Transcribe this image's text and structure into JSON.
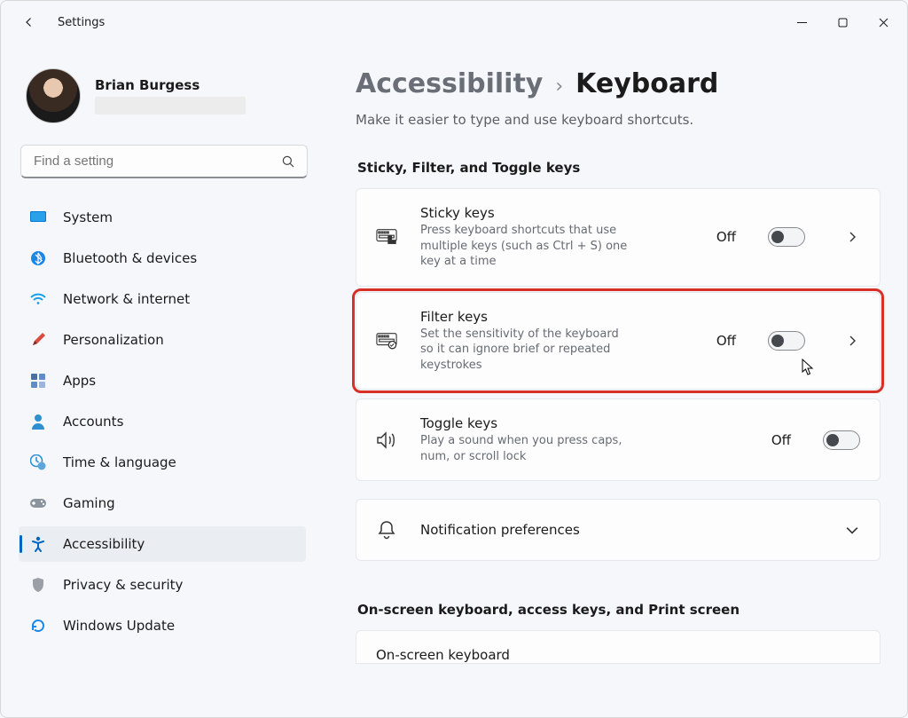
{
  "app_title": "Settings",
  "user": {
    "name": "Brian Burgess"
  },
  "search": {
    "placeholder": "Find a setting"
  },
  "nav": {
    "items": [
      {
        "id": "system",
        "label": "System"
      },
      {
        "id": "bluetooth",
        "label": "Bluetooth & devices"
      },
      {
        "id": "network",
        "label": "Network & internet"
      },
      {
        "id": "personalization",
        "label": "Personalization"
      },
      {
        "id": "apps",
        "label": "Apps"
      },
      {
        "id": "accounts",
        "label": "Accounts"
      },
      {
        "id": "time",
        "label": "Time & language"
      },
      {
        "id": "gaming",
        "label": "Gaming"
      },
      {
        "id": "accessibility",
        "label": "Accessibility",
        "selected": true
      },
      {
        "id": "privacy",
        "label": "Privacy & security"
      },
      {
        "id": "update",
        "label": "Windows Update"
      }
    ]
  },
  "breadcrumb": {
    "parent": "Accessibility",
    "current": "Keyboard"
  },
  "subtitle": "Make it easier to type and use keyboard shortcuts.",
  "sections": {
    "keys": {
      "heading": "Sticky, Filter, and Toggle keys",
      "sticky": {
        "title": "Sticky keys",
        "desc": "Press keyboard shortcuts that use multiple keys (such as Ctrl + S) one key at a time",
        "state": "Off"
      },
      "filter": {
        "title": "Filter keys",
        "desc": "Set the sensitivity of the keyboard so it can ignore brief or repeated keystrokes",
        "state": "Off"
      },
      "toggle": {
        "title": "Toggle keys",
        "desc": "Play a sound when you press caps, num, or scroll lock",
        "state": "Off"
      },
      "notif": {
        "title": "Notification preferences"
      }
    },
    "osk": {
      "heading": "On-screen keyboard, access keys, and Print screen",
      "first": {
        "title": "On-screen keyboard"
      }
    }
  },
  "highlight": {
    "card": "filter"
  }
}
